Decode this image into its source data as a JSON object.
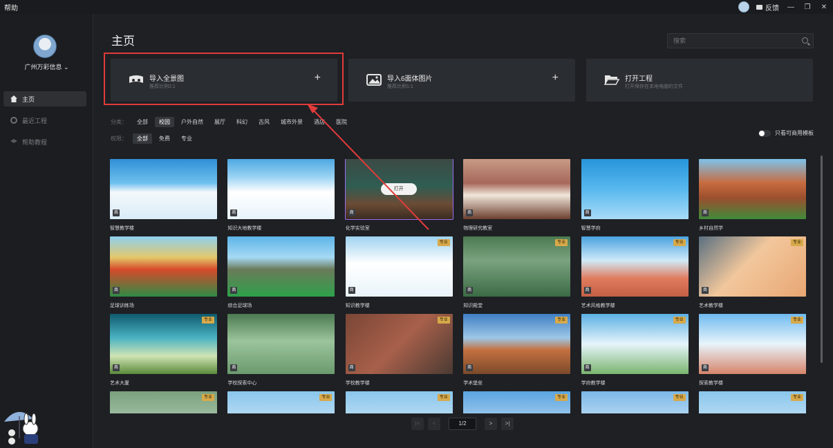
{
  "titlebar": {
    "title": "帮助",
    "feedback": "反馈"
  },
  "sidebar": {
    "user_name": "广州万彩信息",
    "items": [
      {
        "label": "主页",
        "icon": "home-icon",
        "active": true
      },
      {
        "label": "最近工程",
        "icon": "clock-icon",
        "active": false
      },
      {
        "label": "帮助教程",
        "icon": "graduation-cap-icon",
        "active": false
      }
    ]
  },
  "main": {
    "title": "主页",
    "search_placeholder": "搜索",
    "cards": [
      {
        "title": "导入全景图",
        "sub": "推荐比例2:1",
        "plus": "+",
        "icon": "vr-headset-icon"
      },
      {
        "title": "导入6面体图片",
        "sub": "推荐比例1:1",
        "plus": "+",
        "icon": "image-icon"
      },
      {
        "title": "打开工程",
        "sub": "打开保存在本地电脑的文件",
        "plus": "",
        "icon": "folder-open-icon"
      }
    ],
    "filters": {
      "category_label": "分类：",
      "categories": [
        "全部",
        "校园",
        "户外自然",
        "展厅",
        "科幻",
        "古风",
        "城市外景",
        "酒店",
        "医院"
      ],
      "category_selected": 1,
      "permission_label": "权限：",
      "permissions": [
        "全部",
        "免费",
        "专业"
      ],
      "permission_selected": 0
    },
    "toggle_label": "只看可商用模板",
    "open_label": "打开",
    "badge_free": "商",
    "badge_pro": "专业",
    "templates": [
      {
        "name": "智慧教学楼",
        "pro": false
      },
      {
        "name": "知识大地教学楼",
        "pro": false
      },
      {
        "name": "化学实验室",
        "pro": false,
        "selected": true
      },
      {
        "name": "物理研究教室",
        "pro": false
      },
      {
        "name": "智慧学府",
        "pro": false
      },
      {
        "name": "乡村自然学",
        "pro": false
      },
      {
        "name": "足球训练场",
        "pro": false
      },
      {
        "name": "综合足球场",
        "pro": false
      },
      {
        "name": "知识教学楼",
        "pro": true
      },
      {
        "name": "知识殿堂",
        "pro": true
      },
      {
        "name": "艺术风格教学楼",
        "pro": true
      },
      {
        "name": "艺术教学楼",
        "pro": true
      },
      {
        "name": "艺术大厦",
        "pro": true
      },
      {
        "name": "学校探索中心",
        "pro": false
      },
      {
        "name": "学校教学楼",
        "pro": true
      },
      {
        "name": "学术堡垒",
        "pro": true
      },
      {
        "name": "学府教学楼",
        "pro": true
      },
      {
        "name": "探索教学楼",
        "pro": true
      },
      {
        "name": "",
        "pro": true
      },
      {
        "name": "",
        "pro": true
      },
      {
        "name": "",
        "pro": true
      },
      {
        "name": "",
        "pro": true
      },
      {
        "name": "",
        "pro": true
      },
      {
        "name": "",
        "pro": true
      }
    ],
    "pager": {
      "first": "|<",
      "prev": "<",
      "current": "1/2",
      "next": ">",
      "last": ">|"
    }
  },
  "colors": {
    "highlight": "#e23b3b",
    "pro_badge": "#d7a94a",
    "selected_border": "#9b6cf0"
  }
}
